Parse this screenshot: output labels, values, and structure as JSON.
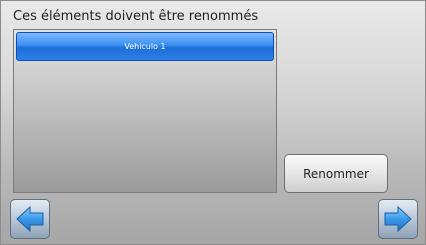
{
  "header": {
    "title": "Ces éléments doivent être renommés"
  },
  "list": {
    "items": [
      {
        "label": "Vehiculo 1",
        "selected": true
      }
    ]
  },
  "actions": {
    "rename_label": "Renommer"
  },
  "navigation": {
    "back_icon": "arrow-left-icon",
    "next_icon": "arrow-right-icon"
  },
  "colors": {
    "selected_item": "#2a7fe6",
    "arrow": "#3a9ae8"
  }
}
